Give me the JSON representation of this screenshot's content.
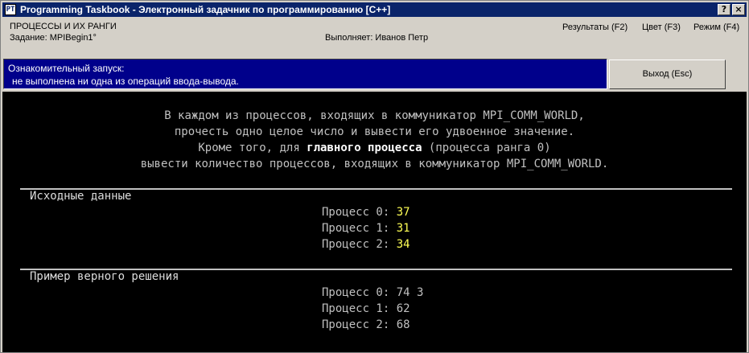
{
  "window": {
    "title": "Programming Taskbook - Электронный задачник по программированию [C++]",
    "help_label": "?",
    "close_label": "×",
    "app_icon_label": "PT"
  },
  "info": {
    "group": "ПРОЦЕССЫ И ИХ РАНГИ",
    "task": "Задание: MPIBegin1°",
    "performer": "Выполняет: Иванов Петр"
  },
  "menu": {
    "results": "Результаты (F2)",
    "color": "Цвет (F3)",
    "mode": "Режим (F4)"
  },
  "status": {
    "line1": "Ознакомительный запуск:",
    "line2": "не выполнена ни одна из операций ввода-вывода."
  },
  "exit_button": "Выход (Esc)",
  "description": {
    "line1": "В каждом из процессов, входящих в коммуникатор MPI_COMM_WORLD,",
    "line2": "прочесть одно целое число и вывести его удвоенное значение.",
    "line3_pre": "Кроме того, для ",
    "line3_bold": "главного процесса",
    "line3_post": " (процесса ранга 0)",
    "line4": "вывести количество процессов, входящих в коммуникатор MPI_COMM_WORLD."
  },
  "input_section": {
    "title": "Исходные данные",
    "rows": [
      {
        "label": "Процесс 0: ",
        "value": "37"
      },
      {
        "label": "Процесс 1: ",
        "value": "31"
      },
      {
        "label": "Процесс 2: ",
        "value": "34"
      }
    ]
  },
  "output_section": {
    "title": "Пример верного решения",
    "rows": [
      {
        "label": "Процесс 0: ",
        "value": "74 3"
      },
      {
        "label": "Процесс 1: ",
        "value": "62"
      },
      {
        "label": "Процесс 2: ",
        "value": "68"
      }
    ]
  }
}
